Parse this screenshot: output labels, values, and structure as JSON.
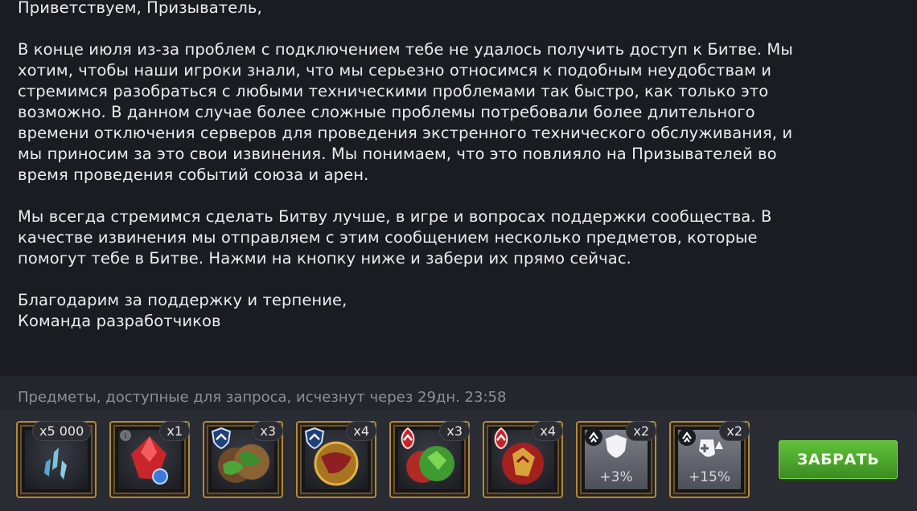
{
  "message": {
    "greeting": "Приветствуем, Призыватель,",
    "paragraph1": "В конце июля из-за проблем с подключением тебе не удалось получить доступ к Битве. Мы\nхотим, чтобы наши игроки знали, что мы серьезно относимся к подобным неудобствам и\nстремимся разобраться с любыми техническими проблемами так быстро, как только это\nвозможно. В данном случае более сложные проблемы потребовали более длительного\nвремени отключения серверов для проведения экстренного технического обслуживания, и\nмы приносим за это свои извинения. Мы понимаем, что это повлияло на Призывателей во\nвремя проведения событий союза и арен.",
    "paragraph2": "Мы всегда стремимся сделать Битву лучше, в игре и вопросах поддержки сообщества. В\nкачестве извинения мы отправляем с этим сообщением несколько предметов, которые\nпомогут тебе в Битве. Нажми на кнопку ниже и забери их прямо сейчас.",
    "closing": "Благодарим за поддержку и терпение,\nКоманда разработчиков"
  },
  "footer": {
    "label": "Предметы, доступные для запроса, исчезнут через 29дн. 23:58",
    "claim_button": "ЗАБРАТЬ"
  },
  "items": [
    {
      "icon": "shard-icon",
      "qty": "x5 000"
    },
    {
      "icon": "crystal-icon",
      "qty": "x1"
    },
    {
      "icon": "green-potion-icon",
      "qty": "x3"
    },
    {
      "icon": "gold-potion-icon",
      "qty": "x4"
    },
    {
      "icon": "green-revive-potion-icon",
      "qty": "x3"
    },
    {
      "icon": "red-revive-potion-icon",
      "qty": "x4"
    },
    {
      "icon": "shield-boost-icon",
      "qty": "x2",
      "pct": "+3%"
    },
    {
      "icon": "health-boost-icon",
      "qty": "x2",
      "pct": "+15%"
    }
  ],
  "colors": {
    "background": "#1b1c22",
    "footer": "#24262d",
    "frame_gold": "#b08a3e",
    "button_green": "#4fa82e"
  }
}
